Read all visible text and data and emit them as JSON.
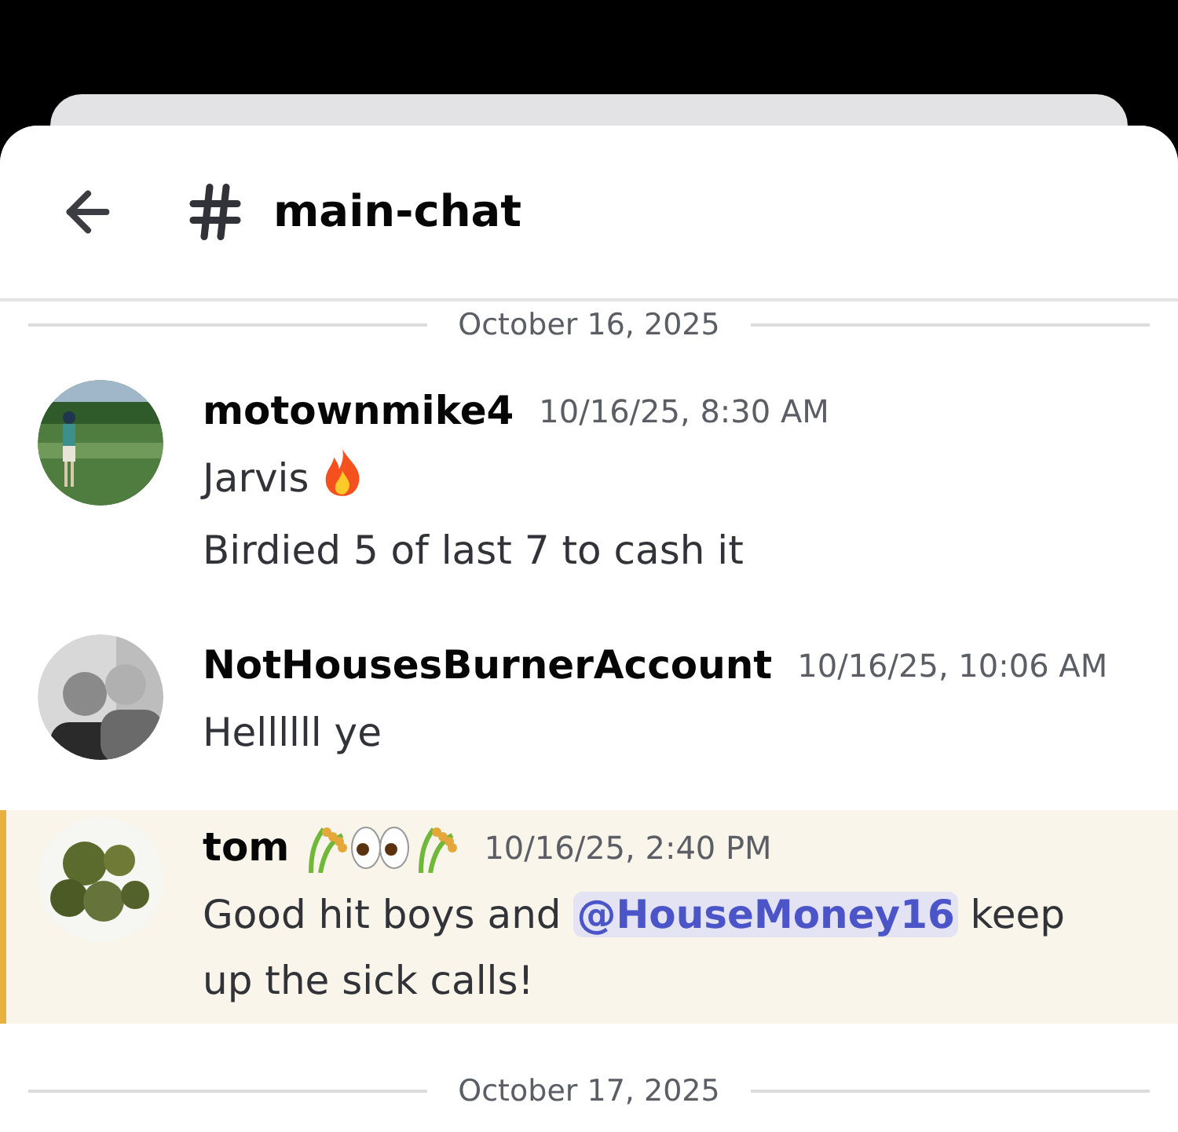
{
  "channel": {
    "name": "main-chat"
  },
  "feed": [
    {
      "kind": "date",
      "text": "October 16, 2025"
    },
    {
      "kind": "message",
      "author": "motownmike4",
      "time": "10/16/25, 8:30 AM",
      "highlighted": false,
      "paragraphs": [
        [
          {
            "kind": "text",
            "text": "Jarvis"
          },
          {
            "kind": "fire"
          }
        ],
        [
          {
            "kind": "text",
            "text": "Birdied 5 of last 7 to cash it"
          }
        ]
      ]
    },
    {
      "kind": "message",
      "author": "NotHousesBurnerAccount",
      "time": "10/16/25, 10:06 AM",
      "highlighted": false,
      "paragraphs": [
        [
          {
            "kind": "text",
            "text": "Hellllll ye"
          }
        ]
      ]
    },
    {
      "kind": "message",
      "author": "tom",
      "time": "10/16/25, 2:40 PM",
      "highlighted": true,
      "badges": [
        {
          "kind": "rice"
        },
        {
          "kind": "eyes"
        },
        {
          "kind": "rice"
        }
      ],
      "paragraphs": [
        [
          {
            "kind": "text",
            "text": "Good hit boys and "
          },
          {
            "kind": "mention",
            "text": "@HouseMoney16"
          },
          {
            "kind": "text",
            "text": "  keep up the sick calls!"
          }
        ]
      ]
    },
    {
      "kind": "date",
      "text": "October 17, 2025"
    }
  ]
}
